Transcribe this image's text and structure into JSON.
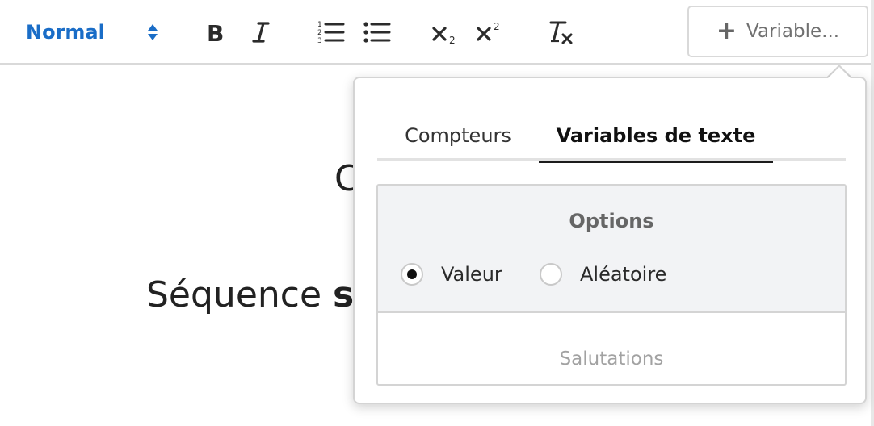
{
  "toolbar": {
    "style_select": {
      "value": "Normal"
    },
    "buttons": [
      {
        "name": "bold",
        "icon": "bold-icon"
      },
      {
        "name": "italic",
        "icon": "italic-icon"
      },
      {
        "name": "ordered-list",
        "icon": "ordered-list-icon"
      },
      {
        "name": "bullet-list",
        "icon": "bullet-list-icon"
      },
      {
        "name": "subscript",
        "icon": "subscript-icon"
      },
      {
        "name": "superscript",
        "icon": "superscript-icon"
      },
      {
        "name": "clear-format",
        "icon": "clear-format-icon"
      }
    ],
    "variable_button": {
      "label": "Variable...",
      "icon": "plus-icon"
    }
  },
  "editor": {
    "line1": "C",
    "line2_normal": "Séquence ",
    "line2_bold": "s"
  },
  "popover": {
    "tabs": [
      {
        "label": "Compteurs",
        "active": false
      },
      {
        "label": "Variables de texte",
        "active": true
      }
    ],
    "options": {
      "title": "Options",
      "radios": [
        {
          "label": "Valeur",
          "checked": true
        },
        {
          "label": "Aléatoire",
          "checked": false
        }
      ]
    },
    "section_label": "Salutations"
  },
  "colors": {
    "accent": "#1a6dc7",
    "panel_bg": "#f2f3f5",
    "border": "#d4d4d4",
    "muted_text": "#a2a2a2"
  }
}
